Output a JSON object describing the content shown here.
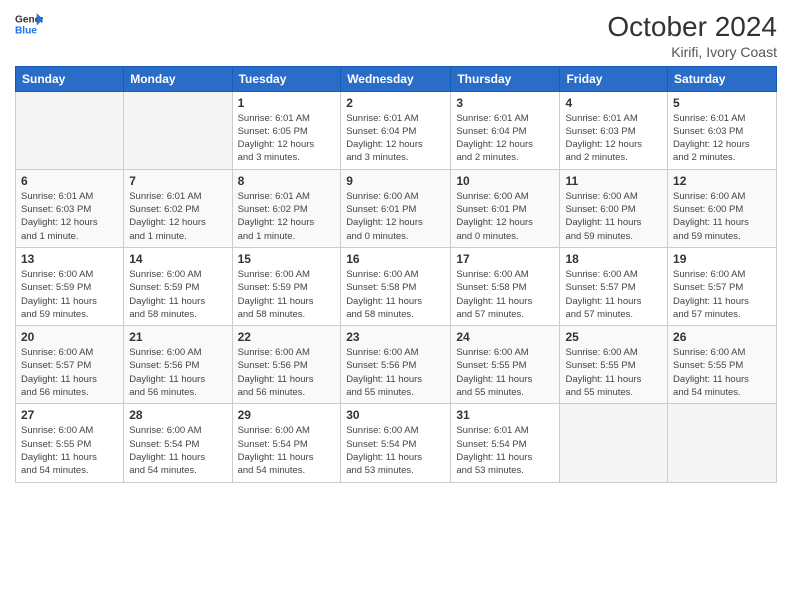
{
  "header": {
    "logo_general": "General",
    "logo_blue": "Blue",
    "title": "October 2024",
    "subtitle": "Kirifi, Ivory Coast"
  },
  "days_of_week": [
    "Sunday",
    "Monday",
    "Tuesday",
    "Wednesday",
    "Thursday",
    "Friday",
    "Saturday"
  ],
  "weeks": [
    [
      {
        "day": "",
        "info": ""
      },
      {
        "day": "",
        "info": ""
      },
      {
        "day": "1",
        "info": "Sunrise: 6:01 AM\nSunset: 6:05 PM\nDaylight: 12 hours\nand 3 minutes."
      },
      {
        "day": "2",
        "info": "Sunrise: 6:01 AM\nSunset: 6:04 PM\nDaylight: 12 hours\nand 3 minutes."
      },
      {
        "day": "3",
        "info": "Sunrise: 6:01 AM\nSunset: 6:04 PM\nDaylight: 12 hours\nand 2 minutes."
      },
      {
        "day": "4",
        "info": "Sunrise: 6:01 AM\nSunset: 6:03 PM\nDaylight: 12 hours\nand 2 minutes."
      },
      {
        "day": "5",
        "info": "Sunrise: 6:01 AM\nSunset: 6:03 PM\nDaylight: 12 hours\nand 2 minutes."
      }
    ],
    [
      {
        "day": "6",
        "info": "Sunrise: 6:01 AM\nSunset: 6:03 PM\nDaylight: 12 hours\nand 1 minute."
      },
      {
        "day": "7",
        "info": "Sunrise: 6:01 AM\nSunset: 6:02 PM\nDaylight: 12 hours\nand 1 minute."
      },
      {
        "day": "8",
        "info": "Sunrise: 6:01 AM\nSunset: 6:02 PM\nDaylight: 12 hours\nand 1 minute."
      },
      {
        "day": "9",
        "info": "Sunrise: 6:00 AM\nSunset: 6:01 PM\nDaylight: 12 hours\nand 0 minutes."
      },
      {
        "day": "10",
        "info": "Sunrise: 6:00 AM\nSunset: 6:01 PM\nDaylight: 12 hours\nand 0 minutes."
      },
      {
        "day": "11",
        "info": "Sunrise: 6:00 AM\nSunset: 6:00 PM\nDaylight: 11 hours\nand 59 minutes."
      },
      {
        "day": "12",
        "info": "Sunrise: 6:00 AM\nSunset: 6:00 PM\nDaylight: 11 hours\nand 59 minutes."
      }
    ],
    [
      {
        "day": "13",
        "info": "Sunrise: 6:00 AM\nSunset: 5:59 PM\nDaylight: 11 hours\nand 59 minutes."
      },
      {
        "day": "14",
        "info": "Sunrise: 6:00 AM\nSunset: 5:59 PM\nDaylight: 11 hours\nand 58 minutes."
      },
      {
        "day": "15",
        "info": "Sunrise: 6:00 AM\nSunset: 5:59 PM\nDaylight: 11 hours\nand 58 minutes."
      },
      {
        "day": "16",
        "info": "Sunrise: 6:00 AM\nSunset: 5:58 PM\nDaylight: 11 hours\nand 58 minutes."
      },
      {
        "day": "17",
        "info": "Sunrise: 6:00 AM\nSunset: 5:58 PM\nDaylight: 11 hours\nand 57 minutes."
      },
      {
        "day": "18",
        "info": "Sunrise: 6:00 AM\nSunset: 5:57 PM\nDaylight: 11 hours\nand 57 minutes."
      },
      {
        "day": "19",
        "info": "Sunrise: 6:00 AM\nSunset: 5:57 PM\nDaylight: 11 hours\nand 57 minutes."
      }
    ],
    [
      {
        "day": "20",
        "info": "Sunrise: 6:00 AM\nSunset: 5:57 PM\nDaylight: 11 hours\nand 56 minutes."
      },
      {
        "day": "21",
        "info": "Sunrise: 6:00 AM\nSunset: 5:56 PM\nDaylight: 11 hours\nand 56 minutes."
      },
      {
        "day": "22",
        "info": "Sunrise: 6:00 AM\nSunset: 5:56 PM\nDaylight: 11 hours\nand 56 minutes."
      },
      {
        "day": "23",
        "info": "Sunrise: 6:00 AM\nSunset: 5:56 PM\nDaylight: 11 hours\nand 55 minutes."
      },
      {
        "day": "24",
        "info": "Sunrise: 6:00 AM\nSunset: 5:55 PM\nDaylight: 11 hours\nand 55 minutes."
      },
      {
        "day": "25",
        "info": "Sunrise: 6:00 AM\nSunset: 5:55 PM\nDaylight: 11 hours\nand 55 minutes."
      },
      {
        "day": "26",
        "info": "Sunrise: 6:00 AM\nSunset: 5:55 PM\nDaylight: 11 hours\nand 54 minutes."
      }
    ],
    [
      {
        "day": "27",
        "info": "Sunrise: 6:00 AM\nSunset: 5:55 PM\nDaylight: 11 hours\nand 54 minutes."
      },
      {
        "day": "28",
        "info": "Sunrise: 6:00 AM\nSunset: 5:54 PM\nDaylight: 11 hours\nand 54 minutes."
      },
      {
        "day": "29",
        "info": "Sunrise: 6:00 AM\nSunset: 5:54 PM\nDaylight: 11 hours\nand 54 minutes."
      },
      {
        "day": "30",
        "info": "Sunrise: 6:00 AM\nSunset: 5:54 PM\nDaylight: 11 hours\nand 53 minutes."
      },
      {
        "day": "31",
        "info": "Sunrise: 6:01 AM\nSunset: 5:54 PM\nDaylight: 11 hours\nand 53 minutes."
      },
      {
        "day": "",
        "info": ""
      },
      {
        "day": "",
        "info": ""
      }
    ]
  ]
}
